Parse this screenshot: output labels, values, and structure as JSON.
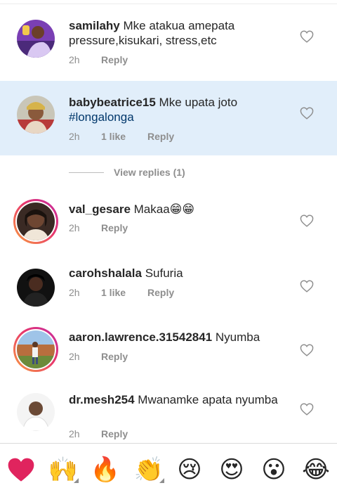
{
  "comments": [
    {
      "username": "samilahy",
      "text": "Mke atakua amepata pressure,kisukari, stress,etc",
      "time": "2h",
      "likes": "",
      "reply_label": "Reply",
      "avatar_icon": "user-photo-icon",
      "highlighted": false,
      "story_ring": false
    },
    {
      "username": "babybeatrice15",
      "text": "Mke upata joto",
      "hashtag": "#longalonga",
      "time": "2h",
      "likes": "1 like",
      "reply_label": "Reply",
      "avatar_icon": "user-photo-icon",
      "highlighted": true,
      "story_ring": false
    },
    {
      "username": "val_gesare",
      "text": "Makaa😁😁",
      "time": "2h",
      "likes": "",
      "reply_label": "Reply",
      "avatar_icon": "user-photo-icon",
      "highlighted": false,
      "story_ring": true
    },
    {
      "username": "carohshalala",
      "text": "Sufuria",
      "time": "2h",
      "likes": "1 like",
      "reply_label": "Reply",
      "avatar_icon": "user-photo-icon",
      "highlighted": false,
      "story_ring": false
    },
    {
      "username": "aaron.lawrence.31542841",
      "text": "Nyumba",
      "time": "2h",
      "likes": "",
      "reply_label": "Reply",
      "avatar_icon": "user-photo-icon",
      "highlighted": false,
      "story_ring": true
    },
    {
      "username": "dr.mesh254",
      "text": "Mwanamke apata nyumba",
      "time": "2h",
      "likes": "",
      "reply_label": "Reply",
      "avatar_icon": "user-photo-icon",
      "highlighted": false,
      "story_ring": false
    }
  ],
  "view_replies": "View replies (1)",
  "emoji_bar": [
    {
      "name": "red-heart",
      "glyph": "❤️",
      "has_variants": false
    },
    {
      "name": "raising-hands",
      "glyph": "🙌",
      "has_variants": true
    },
    {
      "name": "fire",
      "glyph": "🔥",
      "has_variants": false
    },
    {
      "name": "clapping-hands",
      "glyph": "👏",
      "has_variants": true
    },
    {
      "name": "crying-face",
      "glyph": "😢",
      "has_variants": false
    },
    {
      "name": "heart-eyes",
      "glyph": "😍",
      "has_variants": false
    },
    {
      "name": "astonished-face",
      "glyph": "😮",
      "has_variants": false
    },
    {
      "name": "tears-of-joy",
      "glyph": "😂",
      "has_variants": false
    }
  ],
  "colors": {
    "highlight_bg": "#e1eefa",
    "hashtag": "#00376b",
    "meta_text": "#8e8e8e",
    "story_ring_start": "#f9a03f",
    "story_ring_end": "#c32aa3"
  }
}
